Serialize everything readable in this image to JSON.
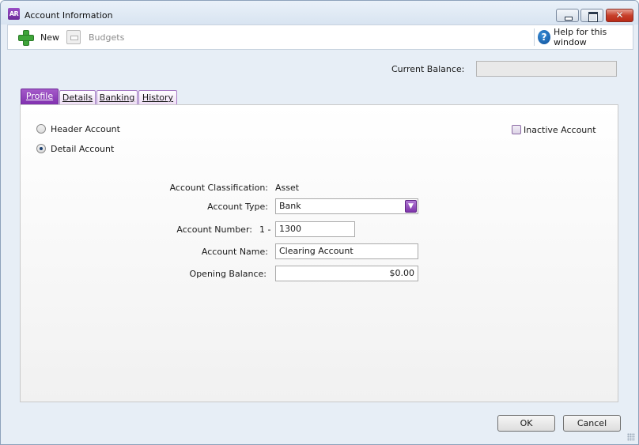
{
  "window": {
    "title": "Account Information",
    "app_icon_text": "AR",
    "close_glyph": "✕"
  },
  "toolbar": {
    "new_label": "New",
    "budgets_label": "Budgets",
    "help_label": "Help for this window",
    "help_glyph": "?"
  },
  "current_balance": {
    "label": "Current Balance:",
    "value": ""
  },
  "tabs": [
    {
      "label": "Profile",
      "active": true
    },
    {
      "label": "Details",
      "active": false
    },
    {
      "label": "Banking",
      "active": false
    },
    {
      "label": "History",
      "active": false
    }
  ],
  "profile": {
    "header_account_label": "Header Account",
    "detail_account_label": "Detail Account",
    "selected_account_kind": "Detail Account",
    "inactive_label": "Inactive Account",
    "inactive_checked": false,
    "classification_label": "Account Classification:",
    "classification_value": "Asset",
    "type_label": "Account Type:",
    "type_value": "Bank",
    "number_label": "Account Number:",
    "number_prefix": "1 -",
    "number_value": "1300",
    "name_label": "Account Name:",
    "name_value": "Clearing Account",
    "opening_label": "Opening Balance:",
    "opening_value": "$0.00"
  },
  "buttons": {
    "ok": "OK",
    "cancel": "Cancel"
  },
  "colors": {
    "tab_active": "#8e3fbc",
    "plus_green": "#3fa53a",
    "help_blue": "#0d4f9a"
  }
}
